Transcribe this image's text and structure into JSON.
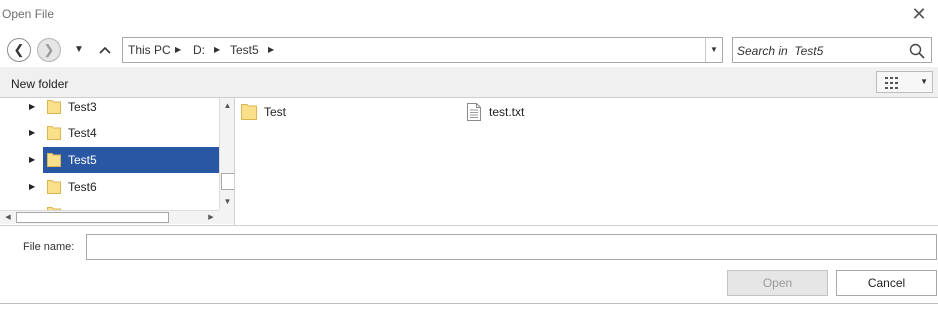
{
  "window": {
    "title": "Open File",
    "close_glyph": "✕"
  },
  "nav": {
    "back_glyph": "❮",
    "forward_glyph": "❯",
    "recent_glyph": "▼",
    "up_glyph": "▲",
    "breadcrumb": [
      "This PC",
      "D:",
      "Test5"
    ],
    "breadcrumb_arrow": "▶",
    "address_dropdown_glyph": "▼"
  },
  "search": {
    "placeholder": "Search in  Test5",
    "value": "",
    "icon": "search-icon"
  },
  "toolbar": {
    "new_folder_label": "New folder",
    "view_dropdown_glyph": "▼",
    "view_icon": "view-grid-icon"
  },
  "tree": {
    "expand_glyph": "▶",
    "items": [
      {
        "label": "Test3",
        "selected": false
      },
      {
        "label": "Test4",
        "selected": false
      },
      {
        "label": "Test5",
        "selected": true
      },
      {
        "label": "Test6",
        "selected": false
      }
    ],
    "scroll_up_glyph": "▲",
    "scroll_down_glyph": "▼",
    "scroll_left_glyph": "◀",
    "scroll_right_glyph": "▶"
  },
  "files": [
    {
      "name": "Test",
      "type": "folder",
      "icon": "folder-icon"
    },
    {
      "name": "test.txt",
      "type": "text-file",
      "icon": "text-file-icon"
    }
  ],
  "footer": {
    "filename_label": "File name:",
    "filename_value": "",
    "open_label": "Open",
    "open_disabled": true,
    "cancel_label": "Cancel"
  },
  "colors": {
    "selection": "#2a57a3",
    "folder_fill": "#fbe08c",
    "folder_stroke": "#dcb653",
    "toolbar_bg": "#f0f0f0",
    "disabled_button_bg": "#e6e6e6"
  }
}
